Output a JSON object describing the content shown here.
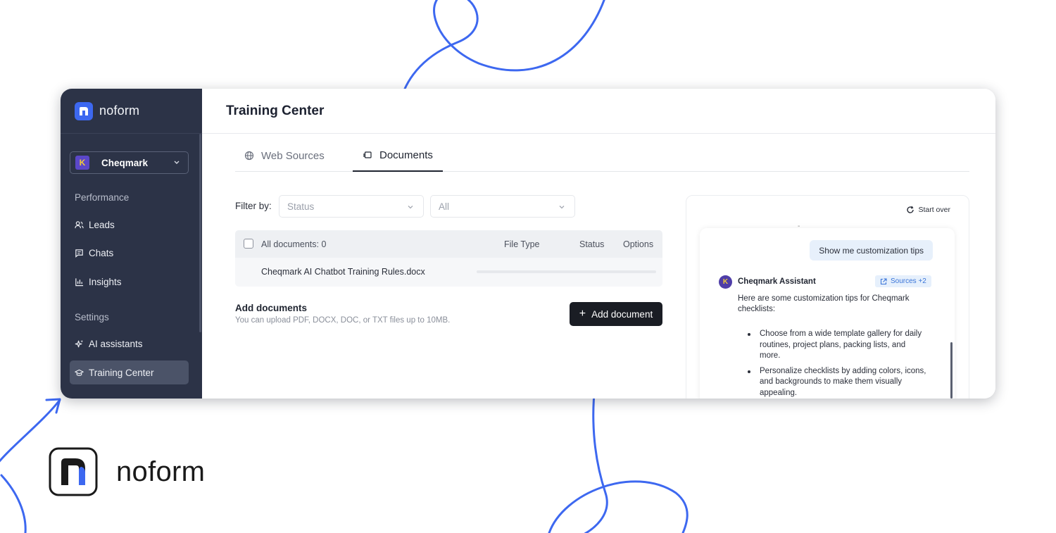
{
  "brand": {
    "name": "noform"
  },
  "colors": {
    "sidebar_bg": "#2c3347",
    "accent": "#3d68f0",
    "curve": "#3d68f0",
    "workspace_logo": "#5b47c9"
  },
  "sidebar": {
    "workspace": {
      "name": "Cheqmark",
      "logo_letter": "K"
    },
    "performance_title": "Performance",
    "items_performance": [
      {
        "label": "Leads",
        "icon": "users-icon"
      },
      {
        "label": "Chats",
        "icon": "chat-icon"
      },
      {
        "label": "Insights",
        "icon": "bar-chart-icon"
      }
    ],
    "settings_title": "Settings",
    "items_settings": [
      {
        "label": "AI assistants",
        "icon": "sparkle-icon"
      },
      {
        "label": "Training Center",
        "icon": "graduation-cap-icon",
        "active": true
      }
    ]
  },
  "header": {
    "title": "Training Center"
  },
  "tabs": [
    {
      "label": "Web Sources",
      "icon": "globe-icon",
      "active": false
    },
    {
      "label": "Documents",
      "icon": "documents-icon",
      "active": true
    }
  ],
  "filters": {
    "label": "Filter by:",
    "status_placeholder": "Status",
    "type_value": "All"
  },
  "table": {
    "count_label": "All documents: 0",
    "columns": [
      "File Type",
      "Status",
      "Options"
    ],
    "rows": [
      {
        "file": "Cheqmark AI Chatbot Training Rules.docx"
      }
    ]
  },
  "add_documents": {
    "title": "Add documents",
    "subtitle": "You can upload PDF, DOCX, DOC, or TXT files up to 10MB.",
    "button_label": "Add document",
    "button_icon": "+"
  },
  "chat": {
    "start_over_label": "Start over",
    "user_message": "Show me customization tips",
    "assistant_name": "Cheqmark Assistant",
    "assistant_avatar_letter": "K",
    "sources_label": "Sources +2",
    "intro": "Here are some customization tips for Cheqmark checklists:",
    "tips": [
      "Choose from a wide template gallery for daily routines, project plans, packing lists, and more.",
      "Personalize checklists by adding colors, icons, and backgrounds to make them visually appealing."
    ]
  },
  "footer_logo": {
    "text": "noform"
  }
}
